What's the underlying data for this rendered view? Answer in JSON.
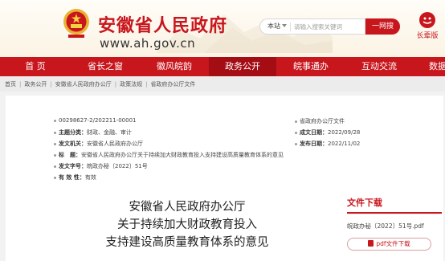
{
  "header": {
    "title": "安徽省人民政府",
    "url": "www.ah.gov.cn",
    "search": {
      "scope": "本站",
      "placeholder": "请输入搜索关键词",
      "button": "一网搜"
    },
    "elder_label": "长辈版"
  },
  "nav": [
    "首 页",
    "省长之窗",
    "徽风皖韵",
    "政务公开",
    "皖事通办",
    "互动交流",
    "数据开放"
  ],
  "breadcrumb": [
    "首页",
    "政务公开",
    "安徽省人民政府办公厅",
    "政策法规",
    "省政府办公厅文件"
  ],
  "meta": {
    "left": [
      {
        "label": "",
        "value": "00298627-2/202211-00001"
      },
      {
        "label": "主题分类：",
        "value": "财政、金融、审计"
      },
      {
        "label": "发文机关：",
        "value": "安徽省人民政府办公厅"
      },
      {
        "label": "标　题：",
        "value": "安徽省人民政府办公厅关于持续加大财政教育投入支持建设高质量教育体系的意见"
      },
      {
        "label": "发文字号：",
        "value": "皖政办秘〔2022〕51号"
      },
      {
        "label": "有 效 性：",
        "value": "有效"
      }
    ],
    "right": [
      {
        "label": "",
        "value": "省政府办公厅文件"
      },
      {
        "label": "成文日期：",
        "value": "2022/09/28"
      },
      {
        "label": "发布日期：",
        "value": "2022/11/02"
      }
    ]
  },
  "document": {
    "title_lines": [
      "安徽省人民政府办公厅",
      "关于持续加大财政教育投入",
      "支持建设高质量教育体系的意见"
    ]
  },
  "download": {
    "title": "文件下载",
    "file_name": "皖政办秘〔2022〕51号.pdf",
    "button": "pdf文件下载"
  },
  "colors": {
    "brand": "#c8161d",
    "nav_active": "#a40d14"
  }
}
